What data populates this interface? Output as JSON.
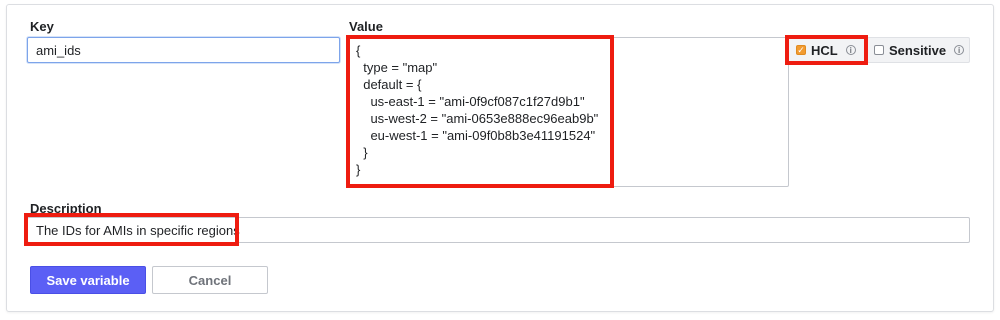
{
  "form": {
    "key_label": "Key",
    "key_value": "ami_ids",
    "value_label": "Value",
    "value_text": "{\n  type = \"map\"\n  default = {\n    us-east-1 = \"ami-0f9cf087c1f27d9b1\"\n    us-west-2 = \"ami-0653e888ec96eab9b\"\n    eu-west-1 = \"ami-09f0b8b3e41191524\"\n  }\n}",
    "hcl_label": "HCL",
    "hcl_checked": true,
    "sensitive_label": "Sensitive",
    "sensitive_checked": false,
    "description_label": "Description",
    "description_value": "The IDs for AMIs in specific regions",
    "save_label": "Save variable",
    "cancel_label": "Cancel"
  },
  "colors": {
    "highlight": "#ee1c10",
    "primary_button": "#5b5ff5",
    "checkbox_checked": "#f29b30"
  }
}
